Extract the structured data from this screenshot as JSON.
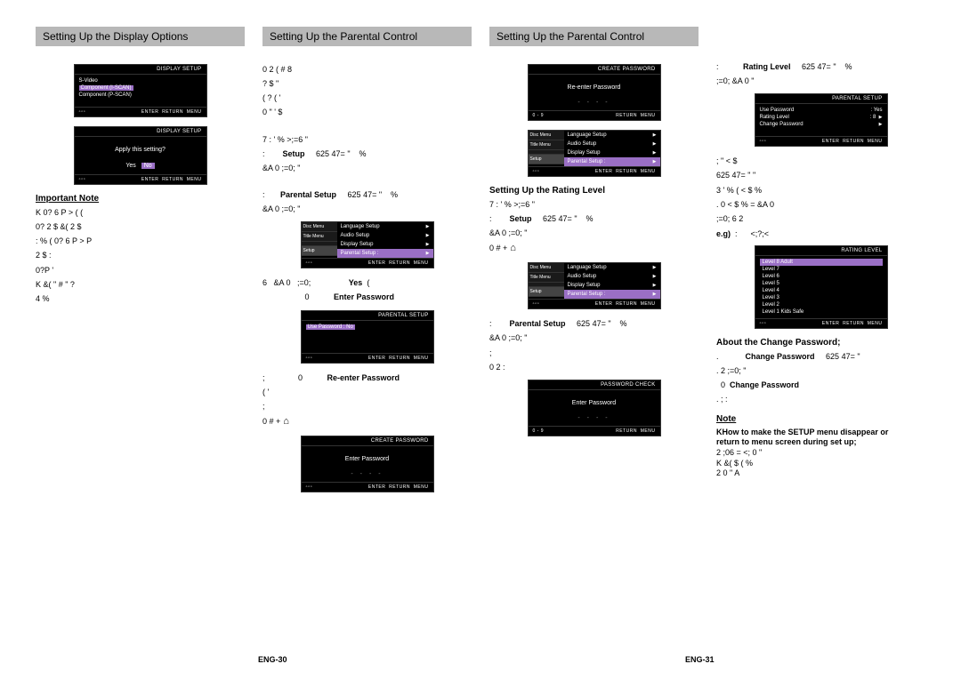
{
  "headings": {
    "h1": "Setting Up the Display Options",
    "h2": "Setting Up the Parental Control",
    "h3": "Setting Up the Parental Control"
  },
  "col1": {
    "osd1_title": "DISPLAY SETUP",
    "osd1_r1": "S-Video",
    "osd1_r2": "Component (I-SCAN)",
    "osd1_r3": "Component (P-SCAN)",
    "osd2_title": "DISPLAY SETUP",
    "osd2_q": "Apply this setting?",
    "osd2_yes": "Yes",
    "osd2_no": "No",
    "impnote": "Important Note",
    "note1": "K            0? 6  P >          (           (",
    "note2": " 0?          2       $    &( 2       $",
    "note3": "  :           % (        0? 6  P  >       P",
    "note4": "                   2      $  :",
    "note5": "    0?P '",
    "note6": "K &(              \" # \"                ?",
    "note7": "  4     %"
  },
  "col2": {
    "intro1": "0  2             (        #          8",
    "intro2": "       ?         $  \"",
    "intro3": "                            ( ?              ( '",
    "intro4": "            0             \"  '      $",
    "step1a": "7               :  '  %        >;=6 \"",
    "step1b": ":         Setup       625 47= \"       %",
    "step1c": "  &A 0    ;=0;  \"",
    "step2a": ":        Parental Setup       625 47= \"       %",
    "step2b": "              &A 0    ;=0;  \"",
    "osd3_tabs": [
      "Disc Menu",
      "Title Menu",
      "",
      "Setup"
    ],
    "osd3_items": [
      "Language Setup",
      "Audio Setup",
      "Display Setup",
      "Parental Setup :"
    ],
    "step3a": "6    &A 0    ;=0;                    Yes   (",
    "step3b": "                       0             Enter Password",
    "osd4_title": "PARENTAL SETUP",
    "osd4_row": "Use Password         : No",
    "step4a": ";                  0             Re-enter Password",
    "step4b": "                                                 ( '",
    "step4c": ";",
    "step4d": "0          # +",
    "osd5_title": "CREATE PASSWORD",
    "osd5_label": "Enter Password",
    "osd5_boxes": "- - - -"
  },
  "col3": {
    "osd6_title": "CREATE PASSWORD",
    "osd6_label": "Re-enter Password",
    "osd6_boxes": "- - - -",
    "osd6_foot_left": "0 - 9",
    "osd7_items": [
      "Language Setup",
      "Audio Setup",
      "Display Setup",
      "Parental Setup :"
    ],
    "subhead": "Setting Up the Rating Level",
    "step1a": "7               :  '  %        >;=6 \"",
    "step1b": ":         Setup       625 47= \"       %",
    "step1c": "  &A 0    ;=0;  \"",
    "step1d": "0            # +",
    "osd8_items": [
      "Language Setup",
      "Audio Setup",
      "Display Setup",
      "Parental Setup :"
    ],
    "step2a": ":          Parental Setup       625 47= \"       %",
    "step2b": "               &A 0    ;=0;  \"",
    "step2c": ";",
    "step2d": "0   2              :",
    "osd9_title": "PASSWORD CHECK",
    "osd9_label": "Enter Password",
    "osd9_boxes": "- - - -",
    "osd9_foot_left": "0 - 9"
  },
  "col4": {
    "step3a": ":             Rating Level       625 47= \"       %",
    "step3b": "              ;=0;       &A 0 \"",
    "osd10_title": "PARENTAL SETUP",
    "osd10_r1l": "Use Password",
    "osd10_r1r": ": Yes",
    "osd10_r2l": "Rating Level",
    "osd10_r2r": ": 8",
    "osd10_r3l": "Change Password",
    "txt1": ";                 \"   < $",
    "txt2": " 625 47= \"  \"",
    "txt3": "     3 '    % (                  < $     %",
    "txt4": " . 0                  < $  %       =      &A 0",
    "txt5": "   ;=0;      6    2",
    "eg": "e.g)  :        <;?;<",
    "osd11_title": "RATING LEVEL",
    "osd11_list": [
      "Level 8 Adult",
      "Level 7",
      "Level 6",
      "Level 5",
      "Level 4",
      "Level 3",
      "Level 2",
      "Level 1 Kids Safe"
    ],
    "about": "About the Change Password;",
    "ab1": ".              Change Password       625 47= \"",
    "ab2": " .  2    ;=0;  \"",
    "ab3": "  0   Change Password",
    "ab4": ". ;                               :",
    "notehead": "Note",
    "noteb1": "KHow to make the SETUP menu disappear or",
    "noteb2": "  return to menu screen during set up;",
    "noteb3": "   2     ;06 =    <; 0 \"",
    "noteb4": "K &(          $    (                  %",
    "noteb5": "   2            0   \"          A"
  },
  "footer": {
    "left_page": "ENG-30",
    "right_page": "ENG-31",
    "enter": "ENTER",
    "return": "RETURN",
    "menu": "MENU"
  }
}
